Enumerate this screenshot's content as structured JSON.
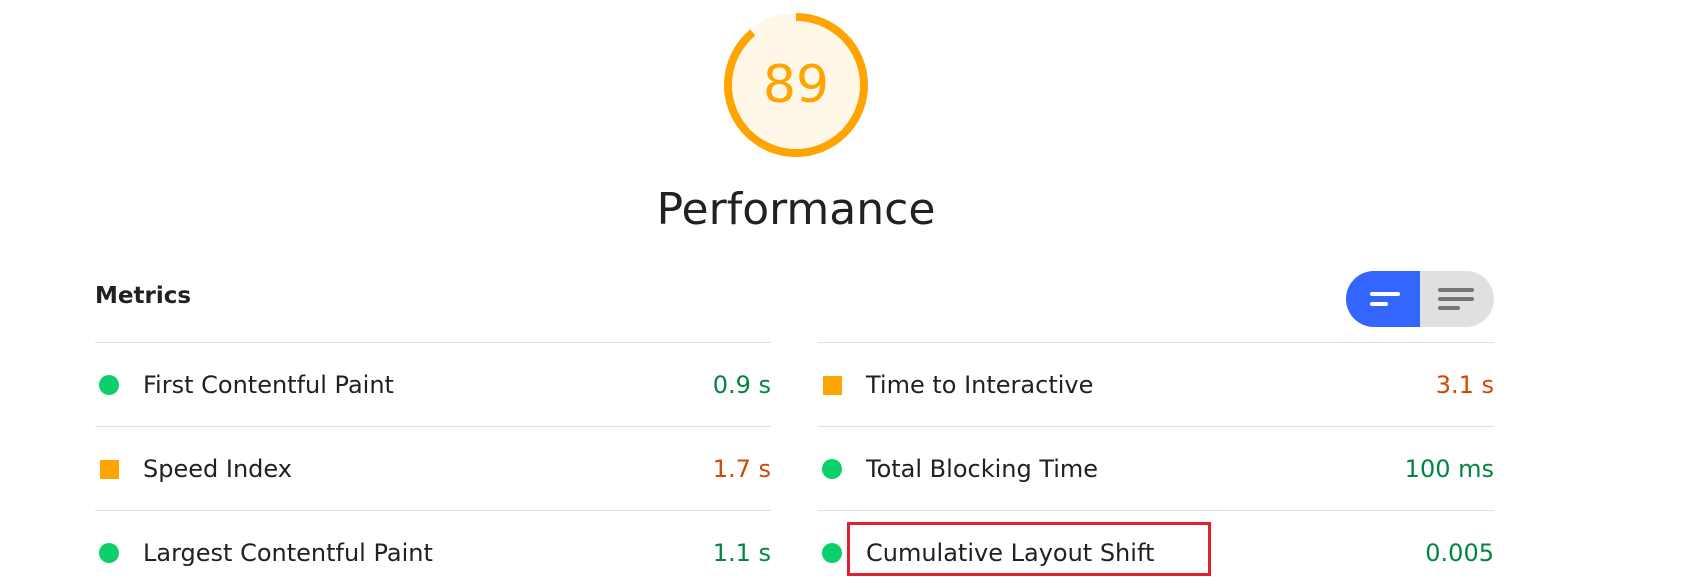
{
  "score": {
    "value": "89",
    "fraction": 0.89,
    "color": "#ffa400",
    "fill": "#fff7e8"
  },
  "category": {
    "title": "Performance"
  },
  "metrics": {
    "header": "Metrics",
    "toggle": {
      "active": "compact-view",
      "active_color": "#3366ff",
      "inactive_color": "#e0e0e0"
    },
    "left": [
      {
        "label": "First Contentful Paint",
        "value": "0.9 s",
        "status": "pass",
        "icon": "green-circle-icon"
      },
      {
        "label": "Speed Index",
        "value": "1.7 s",
        "status": "average",
        "icon": "orange-square-icon"
      },
      {
        "label": "Largest Contentful Paint",
        "value": "1.1 s",
        "status": "pass",
        "icon": "green-circle-icon"
      }
    ],
    "right": [
      {
        "label": "Time to Interactive",
        "value": "3.1 s",
        "status": "average",
        "icon": "orange-square-icon"
      },
      {
        "label": "Total Blocking Time",
        "value": "100 ms",
        "status": "pass",
        "icon": "green-circle-icon"
      },
      {
        "label": "Cumulative Layout Shift",
        "value": "0.005",
        "status": "pass",
        "icon": "green-circle-icon"
      }
    ]
  },
  "highlight_color": "#e0202e"
}
